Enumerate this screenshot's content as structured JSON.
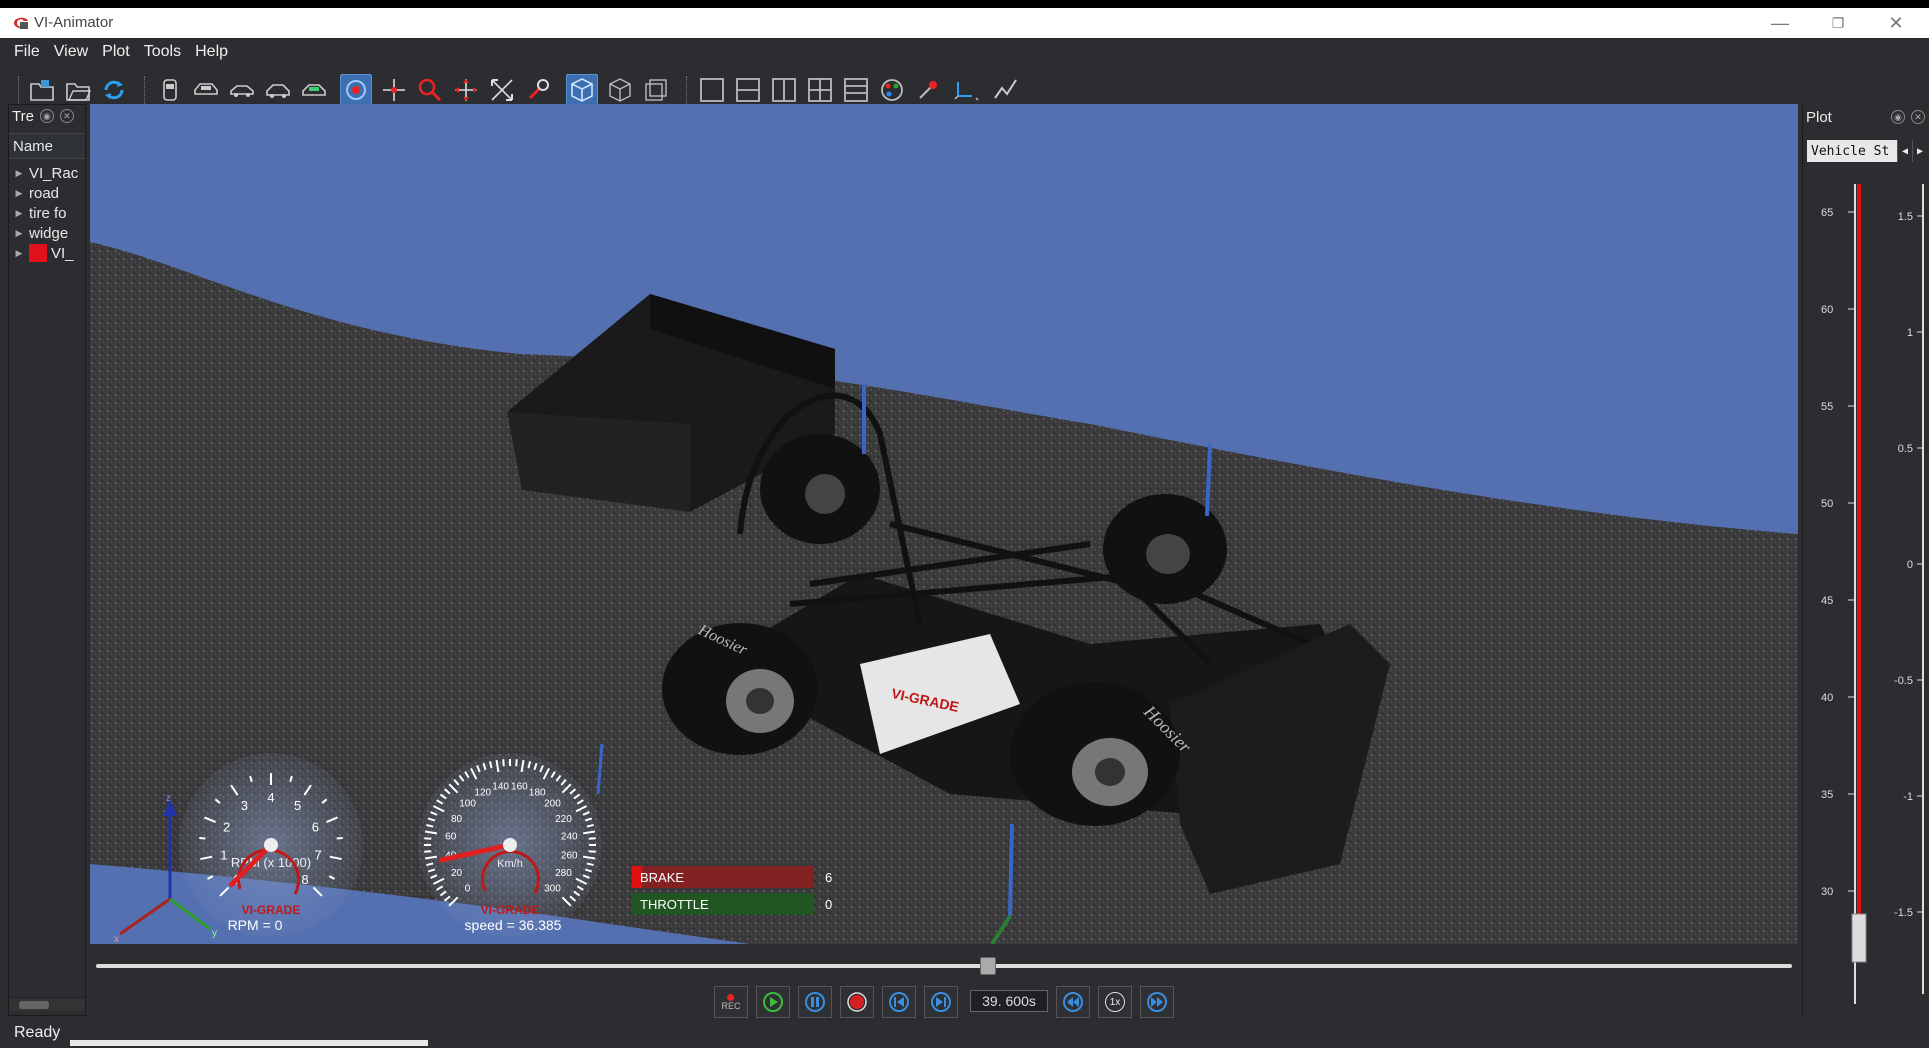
{
  "window": {
    "title": "VI-Animator",
    "minimize": "—",
    "restore": "❐",
    "close": "✕"
  },
  "menu": [
    "File",
    "View",
    "Plot",
    "Tools",
    "Help"
  ],
  "tree": {
    "header": "Tre",
    "column": "Name",
    "items": [
      "VI_Rac",
      "road",
      "tire fo",
      "widge",
      "VI_"
    ]
  },
  "gauges": {
    "rpm": {
      "ticks": [
        "1",
        "2",
        "3",
        "4",
        "5",
        "6",
        "7",
        "8",
        "0"
      ],
      "unit": "RPM (x 1000)",
      "brand": "VI-GRADE",
      "readout": "RPM = 0",
      "value": 0
    },
    "speed": {
      "ticks": [
        "0",
        "20",
        "40",
        "60",
        "80",
        "100",
        "120",
        "140",
        "160",
        "180",
        "200",
        "220",
        "240",
        "260",
        "280",
        "300"
      ],
      "unit": "Km/h",
      "brand": "VI-GRADE",
      "readout": "speed = 36.385",
      "value": 36.385
    }
  },
  "bars": [
    {
      "label": "BRAKE",
      "value": "6",
      "color": "#8b1f1f"
    },
    {
      "label": "THROTTLE",
      "value": "0",
      "color": "#1f5a1f"
    }
  ],
  "axis_triad": {
    "x": "x",
    "y": "y",
    "z": "z"
  },
  "car": {
    "brand": "VI-GRADE",
    "tire_brand": "Hoosier"
  },
  "playback": {
    "rec": "REC",
    "time": "39. 600s",
    "speed": "1x",
    "progress": 0.526
  },
  "status": "Ready",
  "plot": {
    "title": "Plot",
    "selected": "Vehicle St",
    "left_axis": [
      "65",
      "60",
      "55",
      "50",
      "45",
      "40",
      "35",
      "30"
    ],
    "right_axis": [
      "1.5",
      "1",
      "0.5",
      "0",
      "-0.5",
      "-1",
      "-1.5"
    ]
  },
  "colors": {
    "accent": "#3b6fb0",
    "sky": "#5470b0",
    "brake": "#c01818",
    "throttle": "#2e7d32"
  }
}
